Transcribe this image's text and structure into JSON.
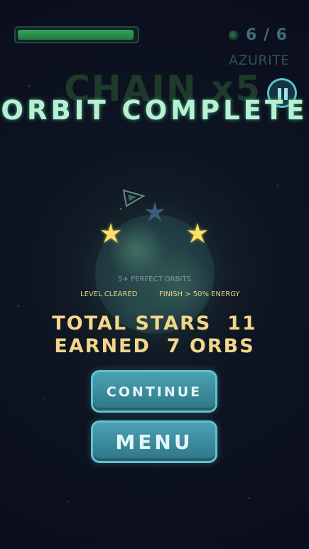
{
  "hud": {
    "energy_fraction": 0.98,
    "orb_counter": "6 / 6",
    "level_name": "AZURITE",
    "chain_text": "CHAIN x5"
  },
  "result": {
    "title": "ORBIT COMPLETE",
    "stars_earned": 2,
    "stars_total": 3,
    "objective_perfect": "5+ PERFECT ORBITS",
    "objective_cleared": "LEVEL CLEARED",
    "objective_finish": "FINISH > 50% ENERGY",
    "total_stars": "TOTAL STARS  11",
    "earned_orbs": "EARNED  7 ORBS"
  },
  "buttons": {
    "continue_label": "CONTINUE",
    "menu_label": "MENU"
  },
  "colors": {
    "accent": "#5cc2d0",
    "gold": "#f2d68a",
    "title": "#b8f0d4"
  },
  "icons": {
    "pause": "pause-icon",
    "star": "star-icon",
    "ship": "ship-icon",
    "orb": "orb-icon"
  }
}
